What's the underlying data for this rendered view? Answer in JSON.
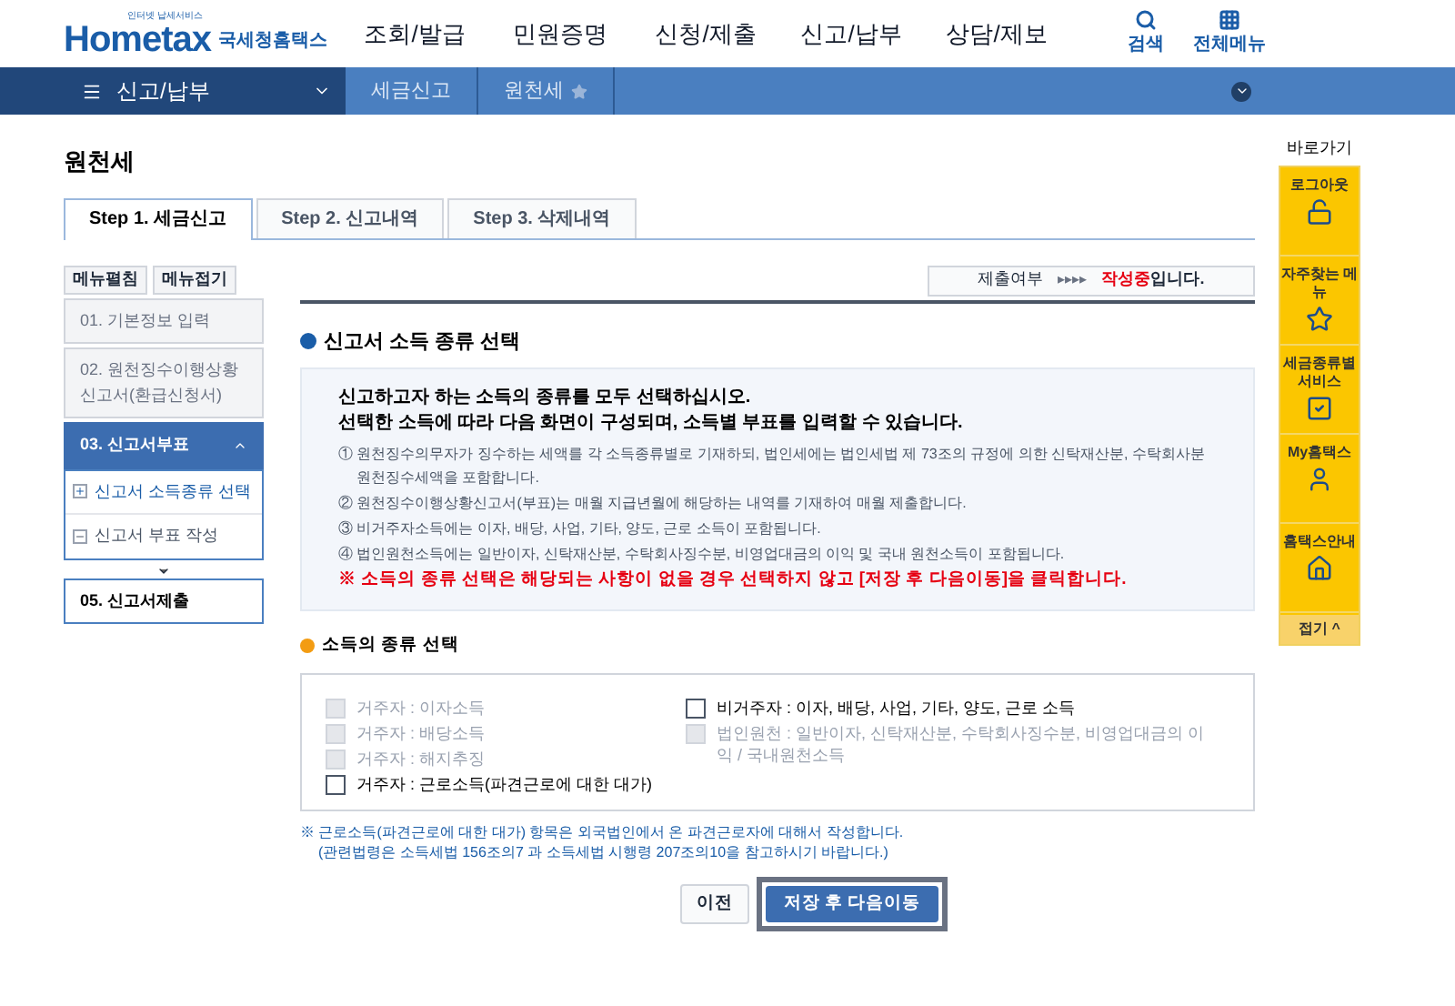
{
  "header": {
    "logo_small": "인터넷 납세서비스",
    "logo": "Hometax",
    "logo_sub": "국세청홈택스",
    "menu": [
      "조회/발급",
      "민원증명",
      "신청/제출",
      "신고/납부",
      "상담/제보"
    ],
    "tools": [
      {
        "kind": "search",
        "label": "검색"
      },
      {
        "kind": "grid",
        "label": "전체메뉴"
      }
    ]
  },
  "nav": {
    "menu": "신고/납부",
    "crumbs": [
      "세금신고",
      "원천세"
    ]
  },
  "page_title": "원천세",
  "tabs": [
    {
      "label": "Step 1. 세금신고",
      "selected": true
    },
    {
      "label": "Step 2. 신고내역",
      "selected": false
    },
    {
      "label": "Step 3. 삭제내역",
      "selected": false
    }
  ],
  "side_buttons": [
    "메뉴펼침",
    "메뉴접기"
  ],
  "side_menu": [
    {
      "label": "01. 기본정보 입력",
      "selected": false
    },
    {
      "label": "02. 원천징수이행상황신고서(환급신청서)",
      "selected": false
    },
    {
      "label": "03. 신고서부표",
      "selected": true,
      "expanded": true,
      "children": [
        {
          "label": "신고서 소득종류 선택",
          "selected": true
        },
        {
          "label": "신고서 부표 작성",
          "selected": false
        }
      ]
    },
    {
      "label": "05. 신고서제출",
      "selected": false
    }
  ],
  "status": {
    "label": "제출여부",
    "arrows": "▸▸▸▸",
    "value": "작성중",
    "suffix": "입니다."
  },
  "section_title": "신고서 소득 종류 선택",
  "info": {
    "lead": [
      "신고하고자 하는 소득의 종류를 모두 선택하십시오.",
      "선택한 소득에 따라 다음 화면이 구성되며, 소득별 부표를 입력할 수 있습니다."
    ],
    "items": [
      "① 원천징수의무자가 징수하는 세액를 각 소득종류별로 기재하되, 법인세에는 법인세법 제 73조의 규정에 의한 신탁재산분, 수탁회사분 원천징수세액을 포함합니다.",
      "② 원천징수이행상황신고서(부표)는 매월 지급년월에 해당하는 내역를 기재하여 매월 제출합니다.",
      "③ 비거주자소득에는 이자, 배당, 사업, 기타, 양도, 근로 소득이 포함됩니다.",
      "④ 법인원천소득에는 일반이자, 신탁재산분, 수탁회사징수분, 비영업대금의 이익 및 국내 원천소득이 포함됩니다."
    ],
    "warning": "※ 소득의 종류 선택은 해당되는 사항이 없을 경우 선택하지 않고 [저장 후 다음이동]을 클릭합니다."
  },
  "choice_title": "소득의 종류 선택",
  "choices": [
    [
      {
        "label": "거주자 : 이자소득",
        "checked": false,
        "disabled": true
      },
      {
        "label": "거주자 : 배당소득",
        "checked": false,
        "disabled": true
      },
      {
        "label": "거주자 : 해지추징",
        "checked": false,
        "disabled": true
      },
      {
        "label": "거주자 : 근로소득(파견근로에 대한 대가)",
        "checked": false,
        "disabled": false
      }
    ],
    [
      {
        "label": "비거주자 : 이자, 배당, 사업, 기타, 양도, 근로 소득",
        "checked": false,
        "disabled": false
      },
      {
        "label": "법인원천 : 일반이자, 신탁재산분, 수탁회사징수분, 비영업대금의 이익 / 국내원천소득",
        "checked": false,
        "disabled": true
      }
    ]
  ],
  "note": [
    "※ 근로소득(파견근로에 대한 대가) 항목은 외국법인에서 온 파견근로자에 대해서 작성합니다.",
    "(관련법령은 소득세법 156조의7 과 소득세법 시행령 207조의10을 참고하시기 바랍니다.)"
  ],
  "buttons": [
    {
      "label": "이전",
      "kind": "secondary"
    },
    {
      "label": "저장 후 다음이동",
      "kind": "primary"
    }
  ],
  "quick": {
    "title": "바로가기",
    "items": [
      {
        "label": "로그아웃",
        "kind": "logout"
      },
      {
        "label": "자주찾는 메뉴",
        "kind": "favorites"
      },
      {
        "label": "세금종류별 서비스",
        "kind": "services"
      },
      {
        "label": "My홈택스",
        "kind": "account"
      },
      {
        "label": "홈택스안내",
        "kind": "guide"
      }
    ],
    "fold": "접기 ^"
  }
}
